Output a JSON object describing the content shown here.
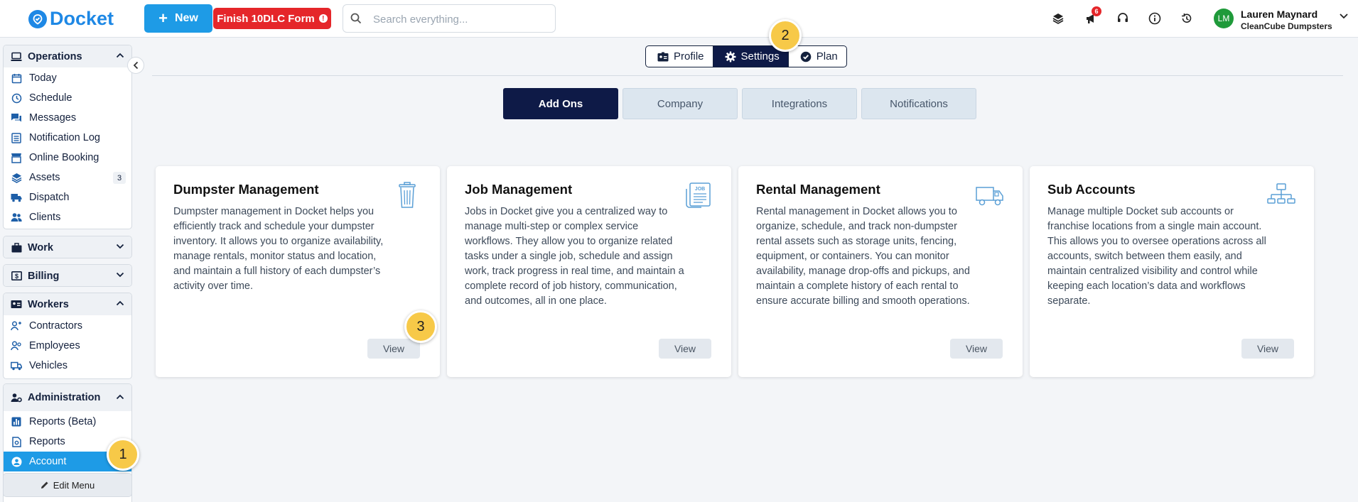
{
  "brand": {
    "name": "Docket"
  },
  "header": {
    "new_label": "New",
    "finish_form_label": "Finish 10DLC Form",
    "search_placeholder": "Search everything...",
    "notification_count": "6",
    "user": {
      "initials": "LM",
      "name": "Lauren Maynard",
      "org": "CleanCube Dumpsters"
    }
  },
  "sidebar": {
    "operations": {
      "title": "Operations",
      "items": [
        {
          "label": "Today"
        },
        {
          "label": "Schedule"
        },
        {
          "label": "Messages"
        },
        {
          "label": "Notification Log"
        },
        {
          "label": "Online Booking"
        },
        {
          "label": "Assets",
          "count": "3"
        },
        {
          "label": "Dispatch"
        },
        {
          "label": "Clients"
        }
      ]
    },
    "work": {
      "title": "Work"
    },
    "billing": {
      "title": "Billing"
    },
    "workers": {
      "title": "Workers",
      "items": [
        {
          "label": "Contractors"
        },
        {
          "label": "Employees"
        },
        {
          "label": "Vehicles"
        }
      ]
    },
    "administration": {
      "title": "Administration",
      "items": [
        {
          "label": "Reports (Beta)"
        },
        {
          "label": "Reports"
        },
        {
          "label": "Account"
        }
      ]
    },
    "edit_menu_label": "Edit Menu"
  },
  "steps": {
    "one": "1",
    "two": "2",
    "three": "3"
  },
  "main": {
    "tabs": [
      {
        "label": "Profile"
      },
      {
        "label": "Settings",
        "active": true
      },
      {
        "label": "Plan"
      }
    ],
    "sub_tabs": [
      {
        "label": "Add Ons",
        "active": true
      },
      {
        "label": "Company"
      },
      {
        "label": "Integrations"
      },
      {
        "label": "Notifications"
      }
    ],
    "cards": [
      {
        "title": "Dumpster Management",
        "icon": "trash-bin-icon",
        "description": "Dumpster management in Docket helps you efficiently track and schedule your dumpster inventory. It allows you to organize availability, manage rentals, monitor status and location, and maintain a full history of each dumpster’s activity over time.",
        "button": "View"
      },
      {
        "title": "Job Management",
        "icon": "job-document-icon",
        "description": "Jobs in Docket give you a centralized way to manage multi-step or complex service workflows. They allow you to organize related tasks under a single job, schedule and assign work, track progress in real time, and maintain a complete record of job history, communication, and outcomes, all in one place.",
        "button": "View"
      },
      {
        "title": "Rental Management",
        "icon": "truck-icon",
        "description": "Rental management in Docket allows you to organize, schedule, and track non-dumpster rental assets such as storage units, fencing, equipment, or containers. You can monitor availability, manage drop-offs and pickups, and maintain a complete history of each rental to ensure accurate billing and smooth operations.",
        "button": "View"
      },
      {
        "title": "Sub Accounts",
        "icon": "org-chart-icon",
        "description": "Manage multiple Docket sub accounts or franchise locations from a single main account. This allows you to oversee operations across all accounts, switch between them easily, and maintain centralized visibility and control while keeping each location’s data and workflows separate.",
        "button": "View"
      }
    ]
  },
  "colors": {
    "accent": "#1e9be6",
    "navy": "#0e1a47",
    "danger": "#e5262a",
    "step": "#f7c948"
  }
}
